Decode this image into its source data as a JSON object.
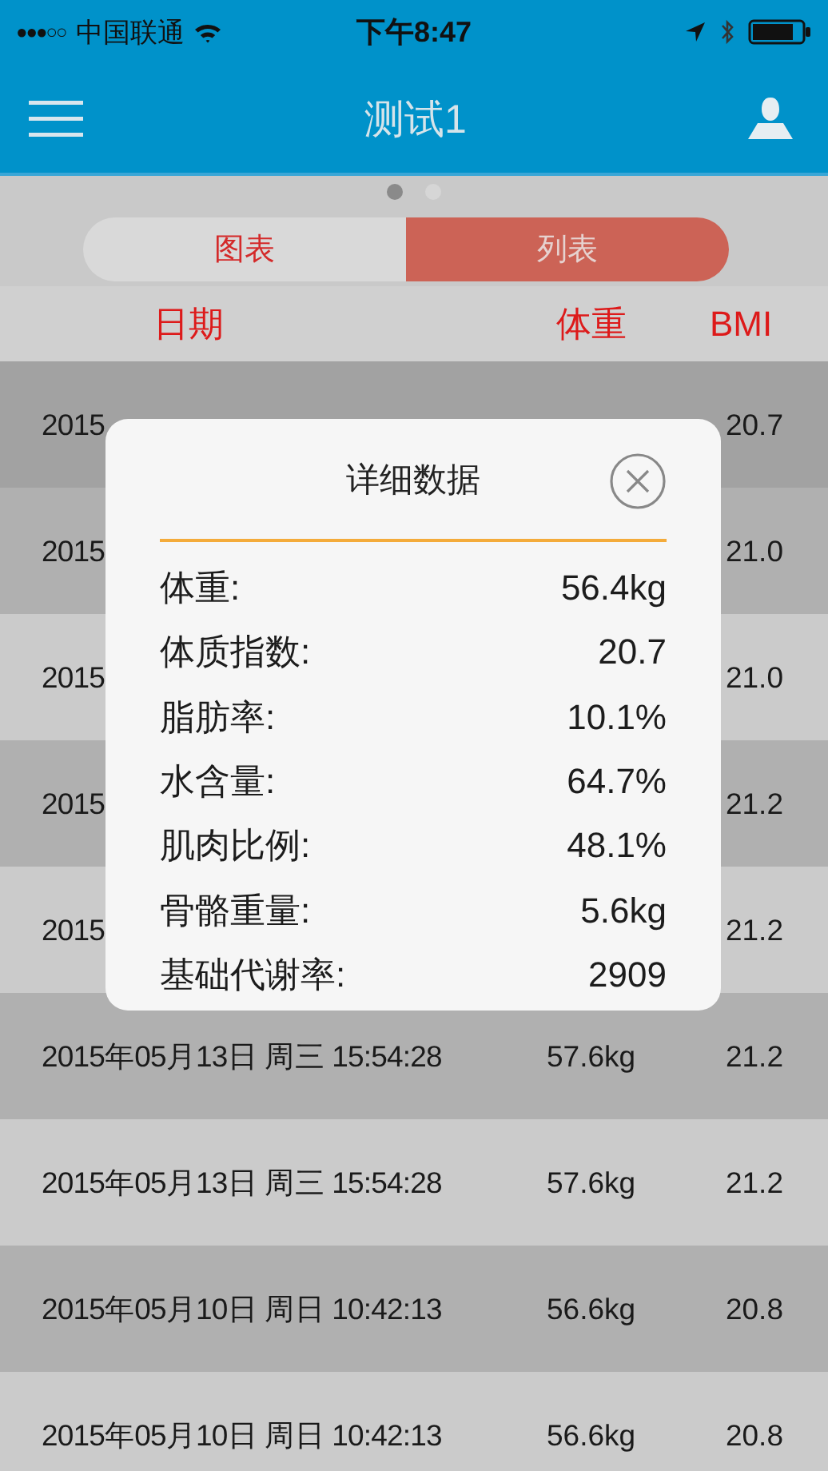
{
  "status_bar": {
    "signal": "●●●○○",
    "carrier": "中国联通",
    "time": "下午8:47"
  },
  "nav_bar": {
    "title": "测试1"
  },
  "page_dots": [
    {
      "selected": true
    },
    {
      "selected": false
    }
  ],
  "tabs": [
    {
      "label": "图表",
      "selected": false
    },
    {
      "label": "列表",
      "selected": true
    }
  ],
  "table": {
    "columns": [
      "日期",
      "体重",
      "BMI"
    ],
    "rows": [
      {
        "date": "2015",
        "bmi": "20.7",
        "selected": true
      },
      {
        "date": "2015",
        "bmi": "21.0",
        "selected": false
      },
      {
        "date": "2015",
        "bmi": "21.0",
        "selected": false
      },
      {
        "date": "2015",
        "bmi": "21.2",
        "selected": false
      },
      {
        "date": "2015",
        "bmi": "21.2",
        "selected": false
      },
      {
        "date": "2015年05月13日 周三 15:54:28",
        "weight": "57.6kg",
        "bmi": "21.2",
        "selected": false
      },
      {
        "date": "2015年05月13日 周三 15:54:28",
        "weight": "57.6kg",
        "bmi": "21.2",
        "selected": false
      },
      {
        "date": "2015年05月10日 周日 10:42:13",
        "weight": "56.6kg",
        "bmi": "20.8",
        "selected": false
      },
      {
        "date": "2015年05月10日 周日 10:42:13",
        "weight": "56.6kg",
        "bmi": "20.8",
        "selected": false
      }
    ]
  },
  "dialog": {
    "title": "详细数据",
    "items": [
      {
        "label": "体重:",
        "value": "56.4kg"
      },
      {
        "label": "体质指数:",
        "value": "20.7"
      },
      {
        "label": "脂肪率:",
        "value": "10.1%"
      },
      {
        "label": "水含量:",
        "value": "64.7%"
      },
      {
        "label": "肌肉比例:",
        "value": "48.1%"
      },
      {
        "label": "骨骼重量:",
        "value": "5.6kg"
      },
      {
        "label": "基础代谢率:",
        "value": "2909"
      }
    ]
  }
}
